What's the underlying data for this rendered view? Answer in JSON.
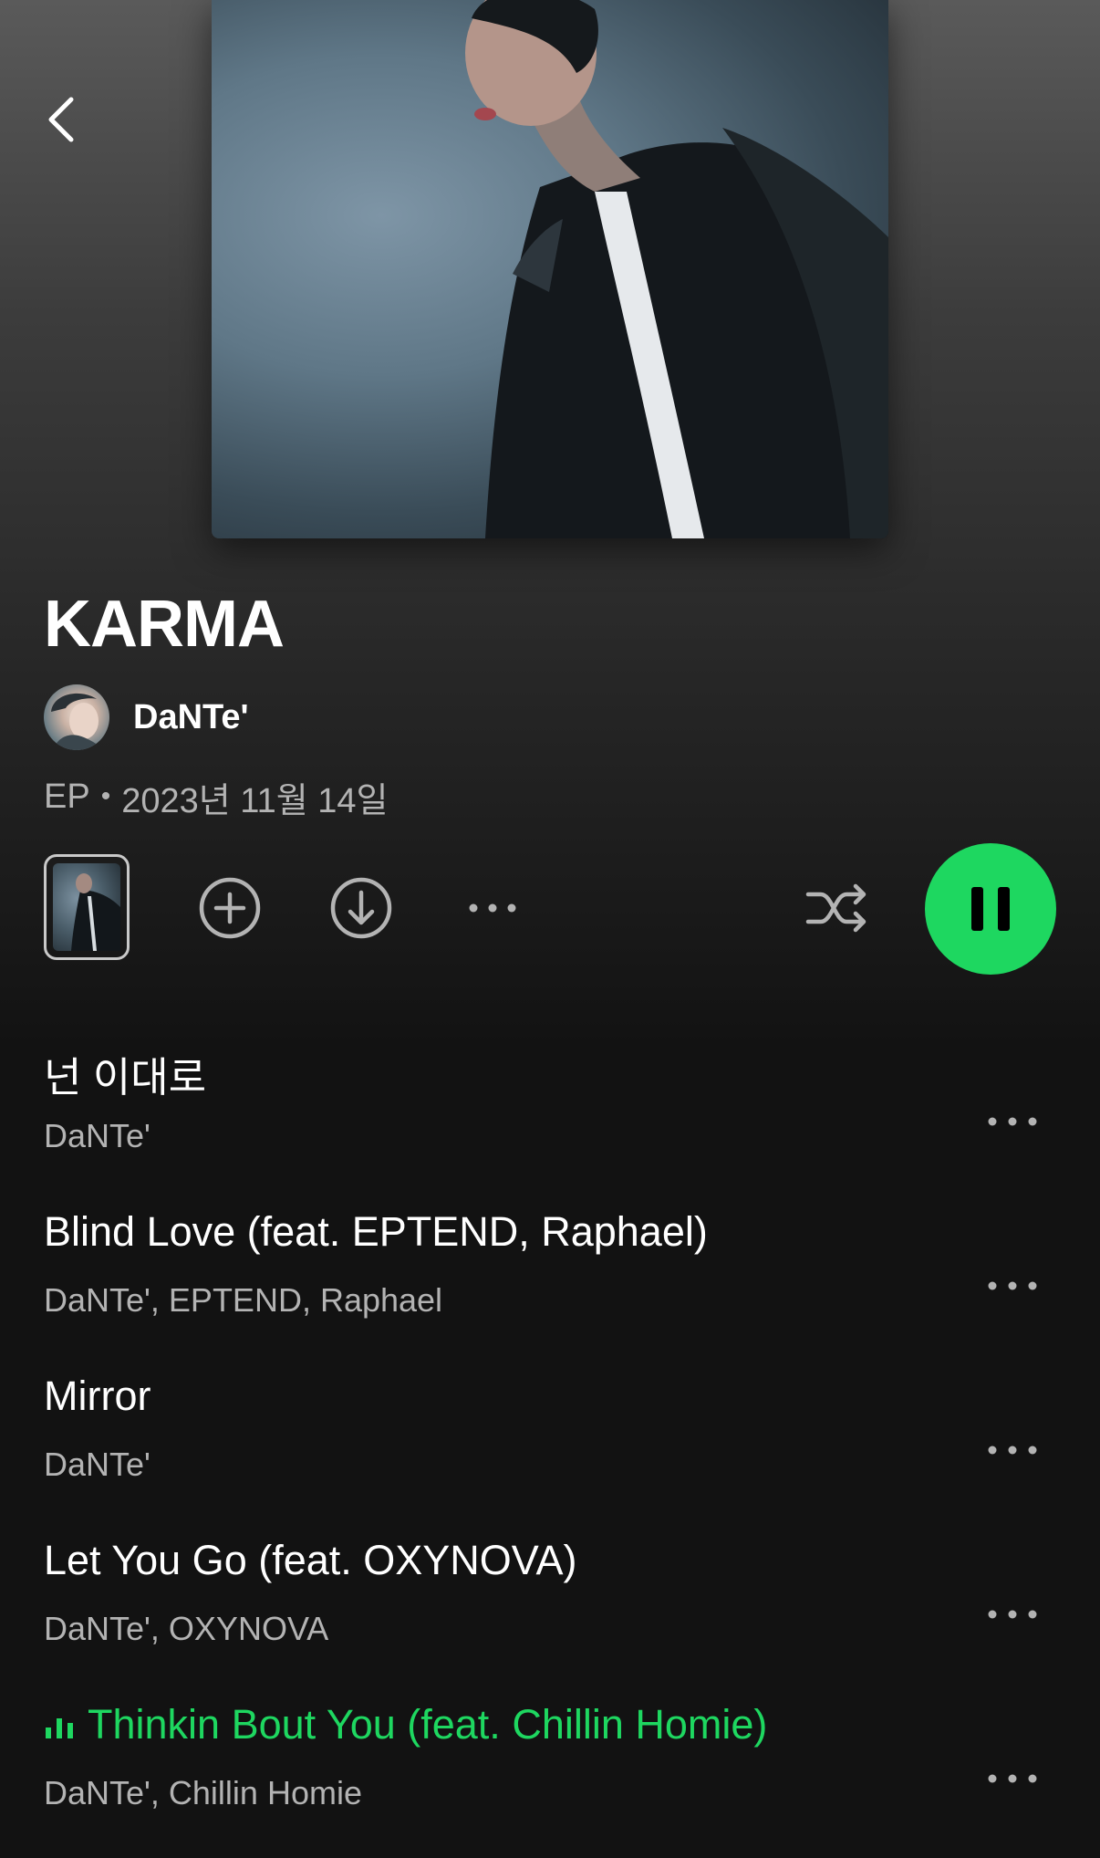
{
  "album": {
    "title": "KARMA",
    "artist": "DaNTe'",
    "type": "EP",
    "separator": "•",
    "release_date": "2023년 11월 14일"
  },
  "icons": {
    "back": "chevron-left-icon",
    "add": "plus-circle-icon",
    "download": "download-circle-icon",
    "more": "more-horizontal-icon",
    "shuffle": "shuffle-icon",
    "pause": "pause-icon",
    "now_playing": "equalizer-bars-icon"
  },
  "colors": {
    "accent": "#1ed760",
    "background": "#121212",
    "secondary_text": "#b3b3b3"
  },
  "tracks": [
    {
      "name": "넌 이대로",
      "artists": "DaNTe'",
      "playing": false
    },
    {
      "name": "Blind Love (feat. EPTEND, Raphael)",
      "artists": "DaNTe', EPTEND, Raphael",
      "playing": false
    },
    {
      "name": "Mirror",
      "artists": "DaNTe'",
      "playing": false
    },
    {
      "name": "Let You Go (feat. OXYNOVA)",
      "artists": "DaNTe', OXYNOVA",
      "playing": false
    },
    {
      "name": "Thinkin Bout You (feat. Chillin Homie)",
      "artists": "DaNTe', Chillin Homie",
      "playing": true
    }
  ]
}
